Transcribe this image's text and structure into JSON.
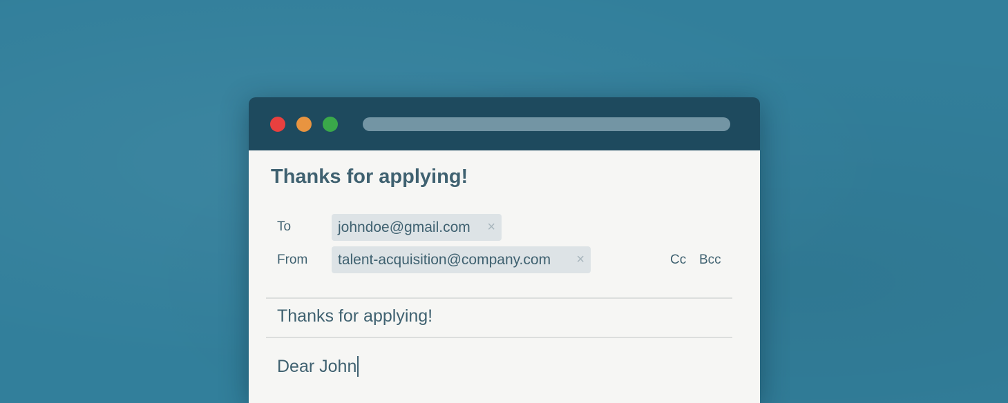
{
  "window": {
    "controls": [
      {
        "name": "close-icon",
        "color": "#e8403f"
      },
      {
        "name": "minimize-icon",
        "color": "#e89440"
      },
      {
        "name": "maximize-icon",
        "color": "#3aa84a"
      }
    ]
  },
  "email": {
    "title": "Thanks for applying!",
    "to_label": "To",
    "to_value": "johndoe@gmail.com",
    "from_label": "From",
    "from_value": "talent-acquisition@company.com",
    "remove_icon": "×",
    "cc_label": "Cc",
    "bcc_label": "Bcc",
    "subject": "Thanks for applying!",
    "body": "Dear John"
  },
  "colors": {
    "background": "#327f9b",
    "titlebar": "#1e4a5e",
    "text": "#3f6170",
    "chip": "#dde3e6"
  }
}
